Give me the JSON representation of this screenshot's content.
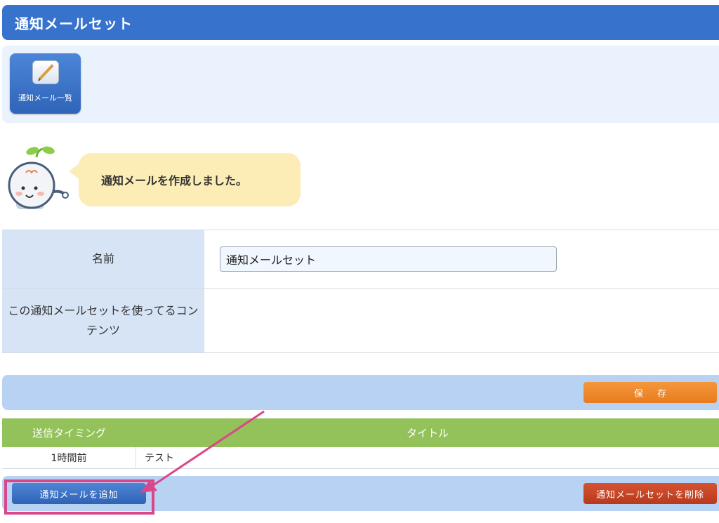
{
  "header": {
    "title": "通知メールセット"
  },
  "toolbar": {
    "list_button_label": "通知メール一覧"
  },
  "message": {
    "text": "通知メールを作成しました。"
  },
  "form": {
    "name_label": "名前",
    "name_value": "通知メールセット",
    "contents_label": "この通知メールセットを使ってるコンテンツ"
  },
  "actions": {
    "save_label": "保存",
    "add_label": "通知メールを追加",
    "delete_label": "通知メールセットを削除"
  },
  "mail_table": {
    "columns": [
      "送信タイミング",
      "タイトル"
    ],
    "rows": [
      {
        "timing": "1時間前",
        "title": "テスト"
      }
    ]
  },
  "colors": {
    "header": "#3773cd",
    "highlight": "#d9478a",
    "table_header": "#93c15a",
    "save": "#e87c1f",
    "delete": "#b83a1c"
  }
}
